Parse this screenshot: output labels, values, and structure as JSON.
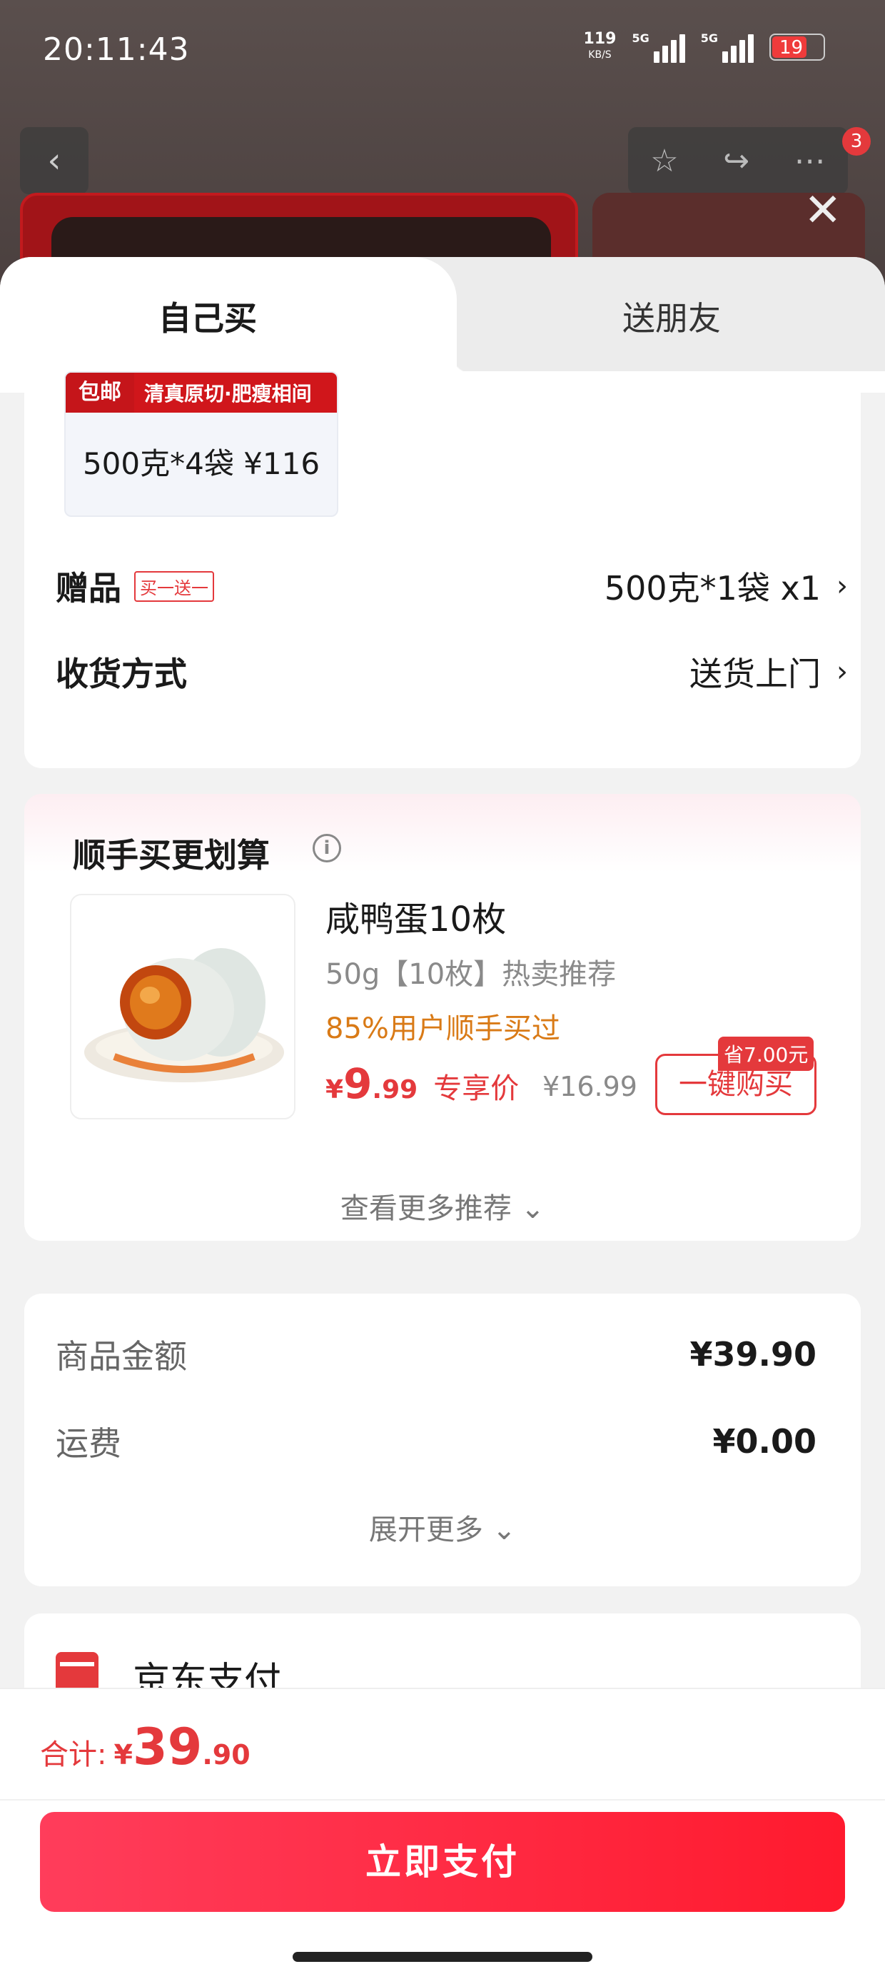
{
  "status_bar": {
    "time": "20:11:43",
    "speed_value": "119",
    "speed_unit": "KB/S",
    "net1": "5G",
    "net2": "5G",
    "battery": "19"
  },
  "nav": {
    "back_icon": "chevron-left-icon",
    "icons": [
      "star-icon",
      "share-icon",
      "more-icon"
    ],
    "badge_count": "3",
    "close_icon": "close-icon"
  },
  "tabs": [
    {
      "label": "自己买"
    },
    {
      "label": "送朋友"
    }
  ],
  "spec_option": {
    "free_shipping": "包邮",
    "tagline": "清真原切·肥瘦相间",
    "label": "500克*4袋 ¥116"
  },
  "gift_row": {
    "label": "赠品",
    "tag": "买一送一",
    "value": "500克*1袋 x1"
  },
  "delivery_row": {
    "label": "收货方式",
    "value": "送货上门"
  },
  "recommend": {
    "title": "顺手买更划算",
    "product_name": "咸鸭蛋10枚",
    "subtitle": "50g【10枚】热卖推荐",
    "buy_rate": "85%用户顺手买过",
    "price_symbol": "¥",
    "price_int": "9",
    "price_dec": ".99",
    "price_label": "专享价",
    "original_price": "¥16.99",
    "save_badge": "省7.00元",
    "buy_button": "一键购买",
    "more_link": "查看更多推荐"
  },
  "summary": {
    "rows": [
      {
        "label": "商品金额",
        "value": "¥39.90"
      },
      {
        "label": "运费",
        "value": "¥0.00"
      }
    ],
    "expand_link": "展开更多"
  },
  "payment": {
    "method": "京东支付"
  },
  "footer": {
    "total_label": "合计:",
    "total_symbol": "¥",
    "total_int": "39",
    "total_dec": ".90",
    "pay_button": "立即支付"
  },
  "colors": {
    "accent": "#e4393c",
    "orange": "#d97a16"
  }
}
